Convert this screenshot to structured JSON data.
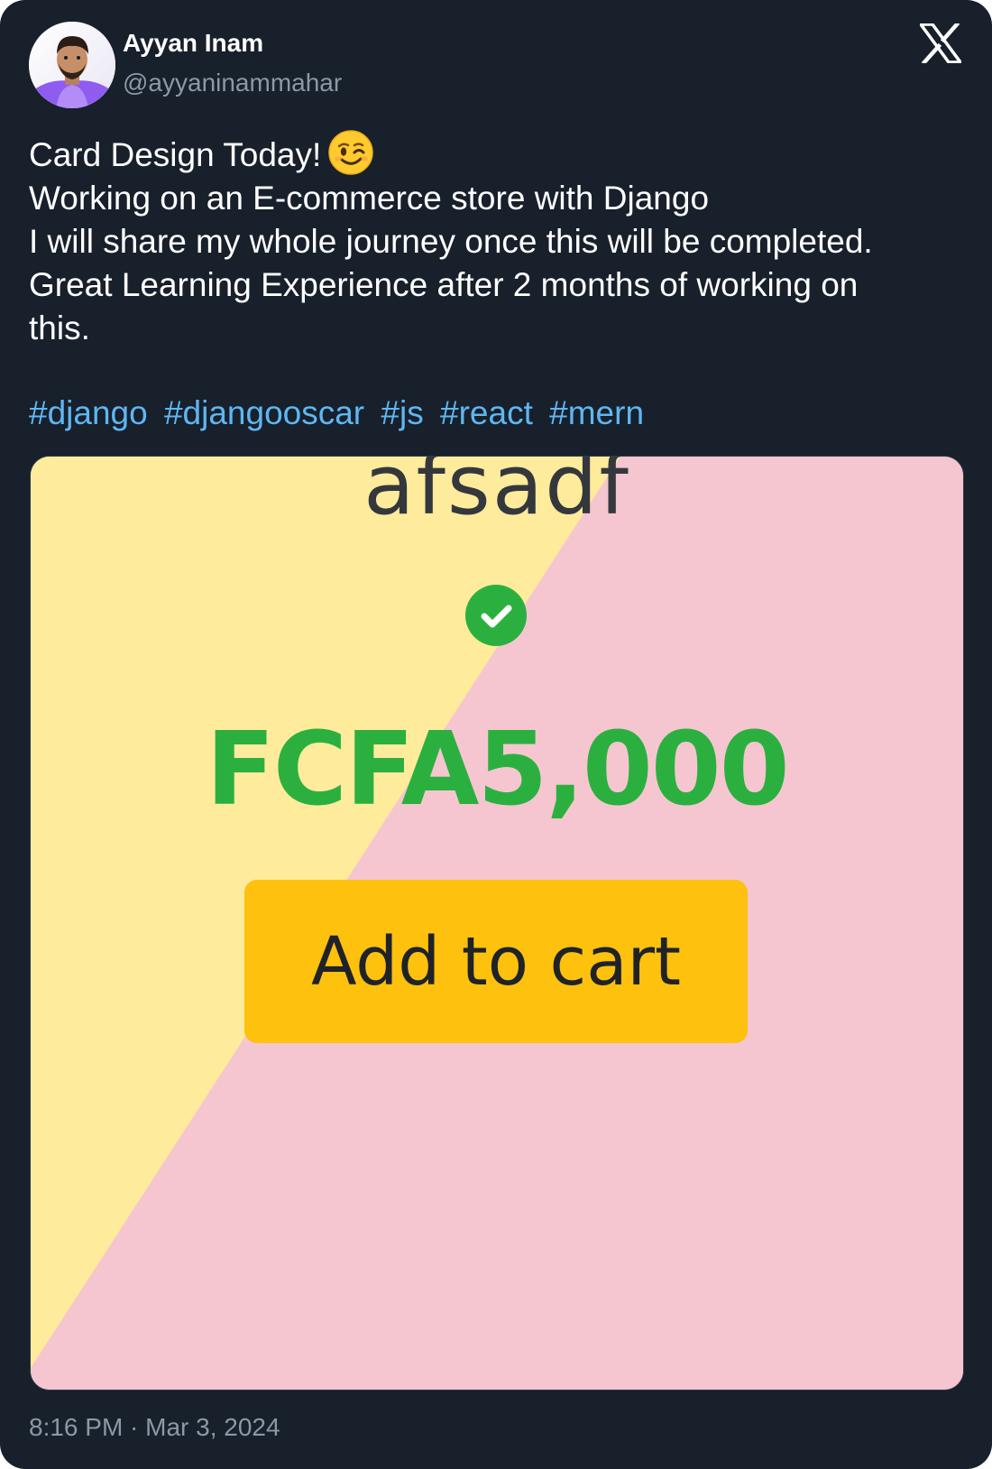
{
  "author": {
    "name": "Ayyan Inam",
    "handle": "@ayyaninammahar"
  },
  "tweet": {
    "lines": [
      "Card Design Today!",
      "Working on an E-commerce store with Django",
      "I will share my whole journey once this will be completed.",
      "Great Learning Experience after 2 months of working on",
      "this."
    ],
    "emoji": "winking-face",
    "hashtags": [
      "#django",
      "#djangooscar",
      "#js",
      "#react",
      "#mern"
    ]
  },
  "media": {
    "product_name": "afsadf",
    "price": "FCFA5,000",
    "button_label": "Add to cart",
    "colors": {
      "yellow_bg": "#feeb9b",
      "pink_bg": "#f5c6cf",
      "price_green": "#2bb040",
      "button_yellow": "#fec10e",
      "check_green": "#2bb040"
    }
  },
  "timestamp": "8:16 PM · Mar 3, 2024",
  "icons": {
    "brand": "x-logo-icon",
    "verified_check": "check-circle-icon"
  }
}
